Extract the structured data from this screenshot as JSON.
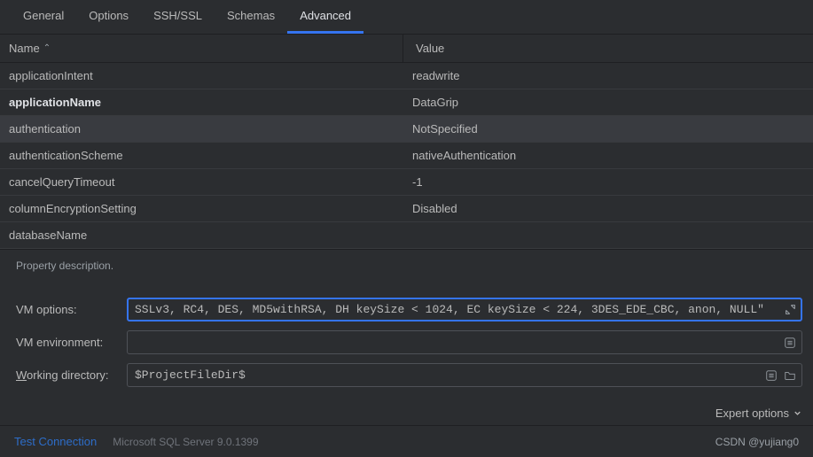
{
  "tabs": [
    {
      "label": "General"
    },
    {
      "label": "Options"
    },
    {
      "label": "SSH/SSL"
    },
    {
      "label": "Schemas"
    },
    {
      "label": "Advanced"
    }
  ],
  "table": {
    "headerName": "Name",
    "headerValue": "Value",
    "rows": [
      {
        "name": "applicationIntent",
        "value": "readwrite"
      },
      {
        "name": "applicationName",
        "value": "DataGrip"
      },
      {
        "name": "authentication",
        "value": "NotSpecified"
      },
      {
        "name": "authenticationScheme",
        "value": "nativeAuthentication"
      },
      {
        "name": "cancelQueryTimeout",
        "value": "-1"
      },
      {
        "name": "columnEncryptionSetting",
        "value": "Disabled"
      },
      {
        "name": "databaseName",
        "value": ""
      }
    ]
  },
  "propertyDesc": "Property description.",
  "form": {
    "vmOptionsLabel": "VM options:",
    "vmOptionsValue": "SSLv3, RC4, DES, MD5withRSA, DH keySize < 1024, EC keySize < 224, 3DES_EDE_CBC, anon, NULL\"",
    "vmEnvLabel": "VM environment:",
    "vmEnvValue": "",
    "workDirLabel": "Working directory:",
    "workDirValue": "$ProjectFileDir$"
  },
  "expertOptions": "Expert options",
  "footer": {
    "testConnection": "Test Connection",
    "serverInfo": "Microsoft SQL Server 9.0.1399",
    "watermark": "CSDN @yujiang0"
  }
}
